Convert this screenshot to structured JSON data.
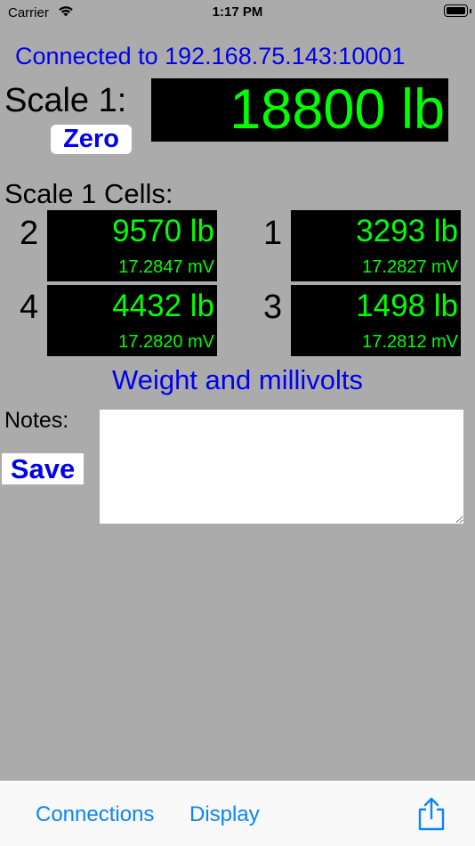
{
  "status_bar": {
    "carrier": "Carrier",
    "time": "1:17 PM"
  },
  "connection": {
    "text": "Connected to 192.168.75.143:10001"
  },
  "scale": {
    "label": "Scale 1:",
    "zero_label": "Zero",
    "value": "18800 lb"
  },
  "cells": {
    "label": "Scale 1 Cells:",
    "items": [
      {
        "num": "2",
        "weight": "9570 lb",
        "mv": "17.2847 mV"
      },
      {
        "num": "1",
        "weight": "3293 lb",
        "mv": "17.2827 mV"
      },
      {
        "num": "4",
        "weight": "4432 lb",
        "mv": "17.2820 mV"
      },
      {
        "num": "3",
        "weight": "1498 lb",
        "mv": "17.2812 mV"
      }
    ]
  },
  "mode_label": "Weight and millivolts",
  "notes": {
    "label": "Notes:",
    "save_label": "Save",
    "value": ""
  },
  "tabs": {
    "connections": "Connections",
    "display": "Display"
  },
  "colors": {
    "background": "#ababab",
    "accent_blue": "#0000ee",
    "display_green": "#00ff00",
    "tab_blue": "#0a84ff"
  }
}
